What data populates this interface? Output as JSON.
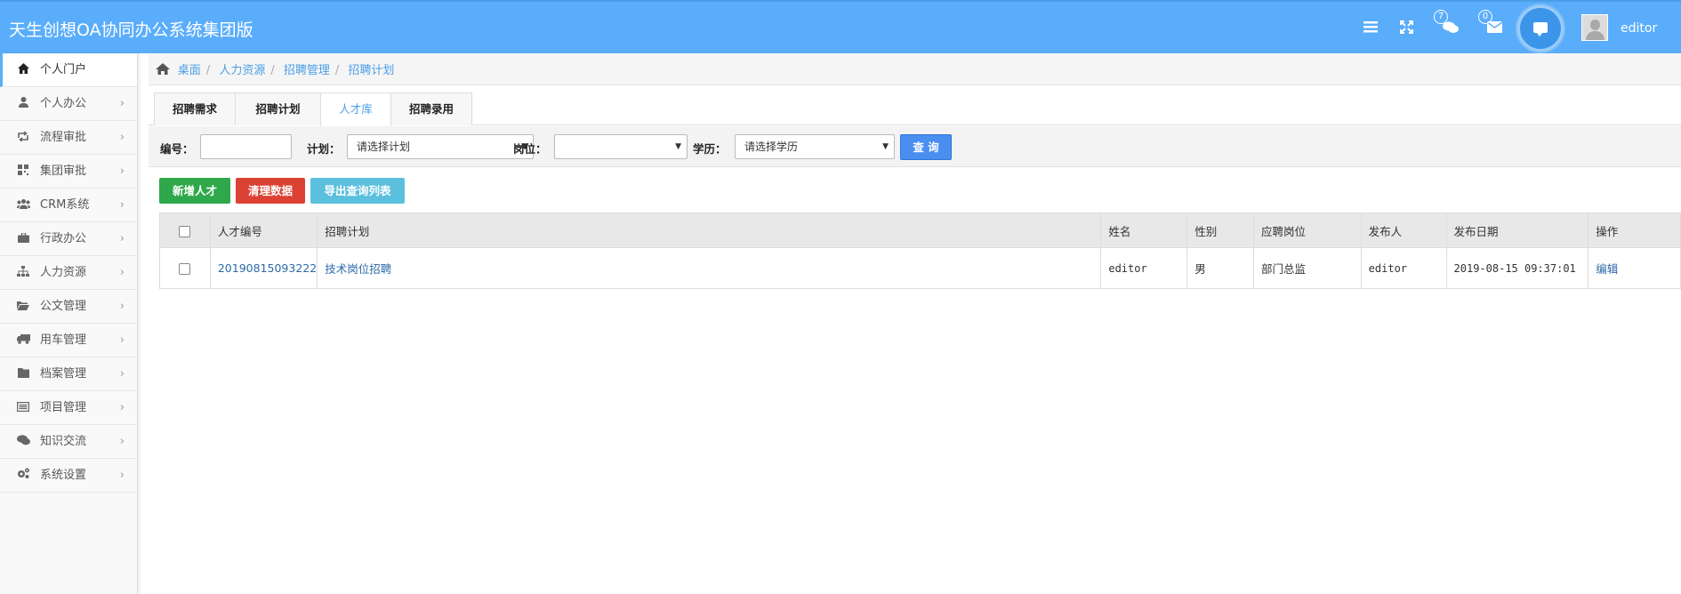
{
  "header": {
    "title": "天生创想OA协同办公系统集团版",
    "badges": {
      "messages": "7",
      "mail": "0"
    },
    "username": "editor"
  },
  "sidebar": {
    "items": [
      {
        "label": "个人门户",
        "icon": "home-icon",
        "active": true
      },
      {
        "label": "个人办公",
        "icon": "user-icon"
      },
      {
        "label": "流程审批",
        "icon": "retweet-icon"
      },
      {
        "label": "集团审批",
        "icon": "qrcode-icon"
      },
      {
        "label": "CRM系统",
        "icon": "users-icon"
      },
      {
        "label": "行政办公",
        "icon": "briefcase-icon"
      },
      {
        "label": "人力资源",
        "icon": "sitemap-icon"
      },
      {
        "label": "公文管理",
        "icon": "folder-open-icon"
      },
      {
        "label": "用车管理",
        "icon": "truck-icon"
      },
      {
        "label": "档案管理",
        "icon": "folder-icon"
      },
      {
        "label": "项目管理",
        "icon": "list-icon"
      },
      {
        "label": "知识交流",
        "icon": "comments-icon"
      },
      {
        "label": "系统设置",
        "icon": "cogs-icon"
      }
    ]
  },
  "breadcrumb": [
    "桌面",
    "人力资源",
    "招聘管理",
    "招聘计划"
  ],
  "tabs": [
    "招聘需求",
    "招聘计划",
    "人才库",
    "招聘录用"
  ],
  "filter": {
    "id_label": "编号：",
    "plan_label": "计划：",
    "plan_value": "请选择计划",
    "position_label": "岗位：",
    "position_value": "",
    "education_label": "学历：",
    "education_value": "请选择学历",
    "query_label": "查 询"
  },
  "actions": {
    "add": "新增人才",
    "clear": "清理数据",
    "export": "导出查询列表"
  },
  "table": {
    "columns": [
      "人才编号",
      "招聘计划",
      "姓名",
      "性别",
      "应聘岗位",
      "发布人",
      "发布日期",
      "操作"
    ],
    "rows": [
      {
        "id": "20190815093222",
        "plan": "技术岗位招聘",
        "name": "editor",
        "gender": "男",
        "position": "部门总监",
        "publisher": "editor",
        "date": "2019-08-15 09:37:01",
        "action": "编辑"
      }
    ]
  },
  "colors": {
    "header_bg": "#5aadfa",
    "primary": "#4a8ef0",
    "success": "#2ea84a",
    "danger": "#dc4234",
    "info": "#5bc0de",
    "link": "#2c6aa8"
  }
}
